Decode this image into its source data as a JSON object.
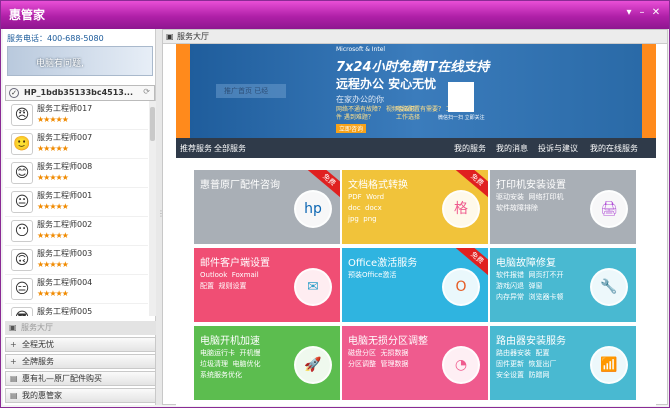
{
  "app": {
    "title": "惠管家"
  },
  "sidebar": {
    "phone_label": "服务电话：",
    "phone_number": "400-688-5080",
    "banner_text": "电脑有问题,",
    "machine_name": "HP_1bdb35133bc4513...",
    "engineers": [
      {
        "name": "服务工程师017",
        "stars": "★★★★★"
      },
      {
        "name": "服务工程师007",
        "stars": "★★★★★"
      },
      {
        "name": "服务工程师008",
        "stars": "★★★★★"
      },
      {
        "name": "服务工程师001",
        "stars": "★★★★★"
      },
      {
        "name": "服务工程师002",
        "stars": "★★★★★"
      },
      {
        "name": "服务工程师003",
        "stars": "★★★★★"
      },
      {
        "name": "服务工程师004",
        "stars": "★★★★★"
      },
      {
        "name": "服务工程师005",
        "stars": ""
      }
    ],
    "menu_header": "服务大厅",
    "menu_items": [
      "全程无忧",
      "全牌服务",
      "惠有礼—原厂配件购买",
      "我的惠管家"
    ]
  },
  "main": {
    "title": "服务大厅",
    "hero": {
      "brand": "Microsoft & Intel",
      "line1": "7x24小时免费IT在线支持",
      "line2": "远程办公 安心无忧",
      "line3": "在家办公的你",
      "tip1": "网络不通有故障？ 视频会议软件 遇到难题？",
      "tip2": "电脑配置有需要？ 工具了工作选择",
      "button": "立即咨询",
      "qr_caption": "微信扫一扫 立即关注",
      "search_hint": "推广首页 已经"
    },
    "nav_left": [
      "推荐服务",
      "全部服务"
    ],
    "nav_right": [
      "我的服务",
      "我的消息",
      "投诉与建议",
      "我的在线服务"
    ],
    "cards": [
      {
        "title": "惠普原厂配件咨询",
        "sub": "",
        "badge": "免费",
        "icon": "hp"
      },
      {
        "title": "文档格式转换",
        "sub": "PDF  Word\ndoc  docx\njpg  png",
        "badge": "免费",
        "icon": "格"
      },
      {
        "title": "打印机安装设置",
        "sub": "驱动安装  网络打印机\n软件故障排除",
        "badge": "",
        "icon": "🖨"
      },
      {
        "title": "邮件客户端设置",
        "sub": "Outlook  Foxmail\n配置  规则设置",
        "badge": "",
        "icon": "✉"
      },
      {
        "title": "Office激活服务",
        "sub": "预装Office激活",
        "badge": "免费",
        "icon": "O"
      },
      {
        "title": "电脑故障修复",
        "sub": "软件报错  网页打不开\n游戏闪退  弹窗\n内存异常  浏览器卡顿",
        "badge": "",
        "icon": "🔧"
      },
      {
        "title": "电脑开机加速",
        "sub": "电脑运行卡  开机慢\n垃圾清理  电脑优化\n系统服务优化",
        "badge": "",
        "icon": "🚀"
      },
      {
        "title": "电脑无损分区调整",
        "sub": "磁盘分区  无损数据\n分区调整  管理数据",
        "badge": "",
        "icon": "◔"
      },
      {
        "title": "路由器安装服务",
        "sub": "路由器安装  配置\n固件更新  恢复出厂\n安全设置  防蹭网",
        "badge": "",
        "icon": "📶"
      }
    ],
    "card_colors": [
      "#a9afb6",
      "#f1c33a",
      "#a9afb6",
      "#f04e74",
      "#2fb4e0",
      "#49b9d1",
      "#5cbd4f",
      "#ef5b8e",
      "#49b9d1"
    ],
    "icon_colors": [
      "#0b66b3",
      "#ef5b8e",
      "#b04fd6",
      "#2fa0c9",
      "#e65b23",
      "#2fa35f",
      "#3f9bd6",
      "#ef5b8e",
      "#2fb4e0"
    ]
  }
}
